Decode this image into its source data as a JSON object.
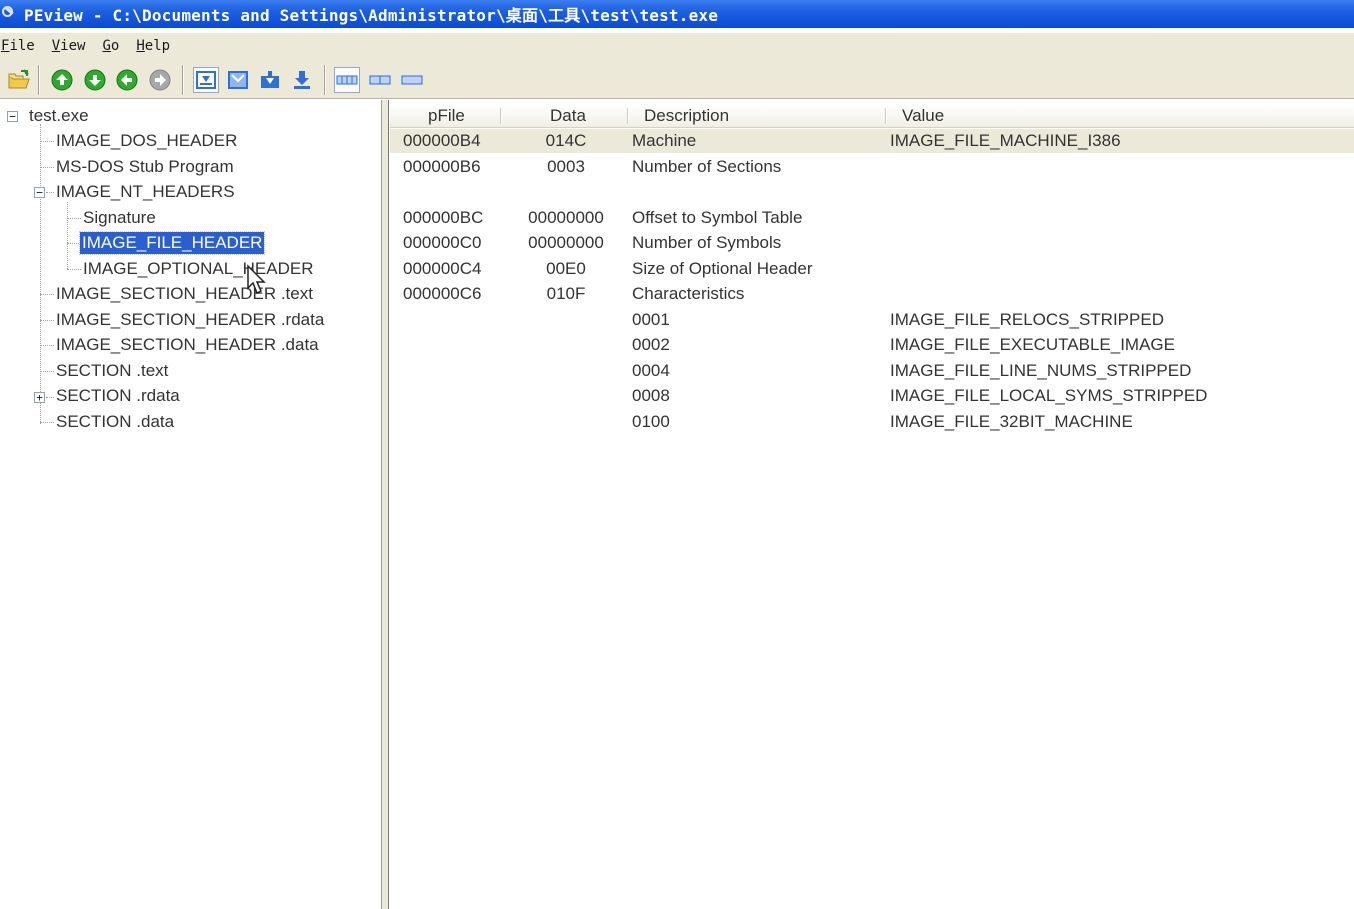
{
  "window": {
    "title": "PEview - C:\\Documents and Settings\\Administrator\\桌面\\工具\\test\\test.exe"
  },
  "menu": [
    {
      "accel": "F",
      "rest": "ile"
    },
    {
      "accel": "V",
      "rest": "iew"
    },
    {
      "accel": "G",
      "rest": "o"
    },
    {
      "accel": "H",
      "rest": "elp"
    }
  ],
  "toolbar": {
    "icons": [
      "open-folder-icon",
      "go-up-icon",
      "go-down-icon",
      "back-icon",
      "forward-icon",
      "view-hex-icon",
      "view-header-icon",
      "view-byte-icon",
      "view-dword-icon",
      "view-format1-icon",
      "view-format2-icon",
      "view-format3-icon"
    ],
    "colors": {
      "green": "#2faa2f",
      "blue": "#2f6fd6",
      "gray": "#9a9a9a"
    }
  },
  "tree": {
    "root": "test.exe",
    "items": [
      "IMAGE_DOS_HEADER",
      "MS-DOS Stub Program",
      "IMAGE_NT_HEADERS",
      "Signature",
      "IMAGE_FILE_HEADER",
      "IMAGE_OPTIONAL_HEADER",
      "IMAGE_SECTION_HEADER .text",
      "IMAGE_SECTION_HEADER .rdata",
      "IMAGE_SECTION_HEADER .data",
      "SECTION .text",
      "SECTION .rdata",
      "SECTION .data"
    ],
    "selected": "IMAGE_FILE_HEADER",
    "expander_minus": "−",
    "expander_plus": "+"
  },
  "list": {
    "columns": [
      "pFile",
      "Data",
      "Description",
      "Value"
    ],
    "rows": [
      {
        "pfile": "000000B4",
        "data": "014C",
        "description": "Machine",
        "value": "IMAGE_FILE_MACHINE_I386"
      },
      {
        "pfile": "000000B6",
        "data": "0003",
        "description": "Number of Sections",
        "value": ""
      },
      {
        "pfile": "",
        "data": "",
        "description": "",
        "value": ""
      },
      {
        "pfile": "000000BC",
        "data": "00000000",
        "description": "Offset to Symbol Table",
        "value": ""
      },
      {
        "pfile": "000000C0",
        "data": "00000000",
        "description": "Number of Symbols",
        "value": ""
      },
      {
        "pfile": "000000C4",
        "data": "00E0",
        "description": "Size of Optional Header",
        "value": ""
      },
      {
        "pfile": "000000C6",
        "data": "010F",
        "description": "Characteristics",
        "value": ""
      },
      {
        "pfile": "",
        "data": "",
        "description": "0001",
        "value": "IMAGE_FILE_RELOCS_STRIPPED"
      },
      {
        "pfile": "",
        "data": "",
        "description": "0002",
        "value": "IMAGE_FILE_EXECUTABLE_IMAGE"
      },
      {
        "pfile": "",
        "data": "",
        "description": "0004",
        "value": "IMAGE_FILE_LINE_NUMS_STRIPPED"
      },
      {
        "pfile": "",
        "data": "",
        "description": "0008",
        "value": "IMAGE_FILE_LOCAL_SYMS_STRIPPED"
      },
      {
        "pfile": "",
        "data": "",
        "description": "0100",
        "value": "IMAGE_FILE_32BIT_MACHINE"
      }
    ],
    "highlight_color": "#ece9d8"
  }
}
